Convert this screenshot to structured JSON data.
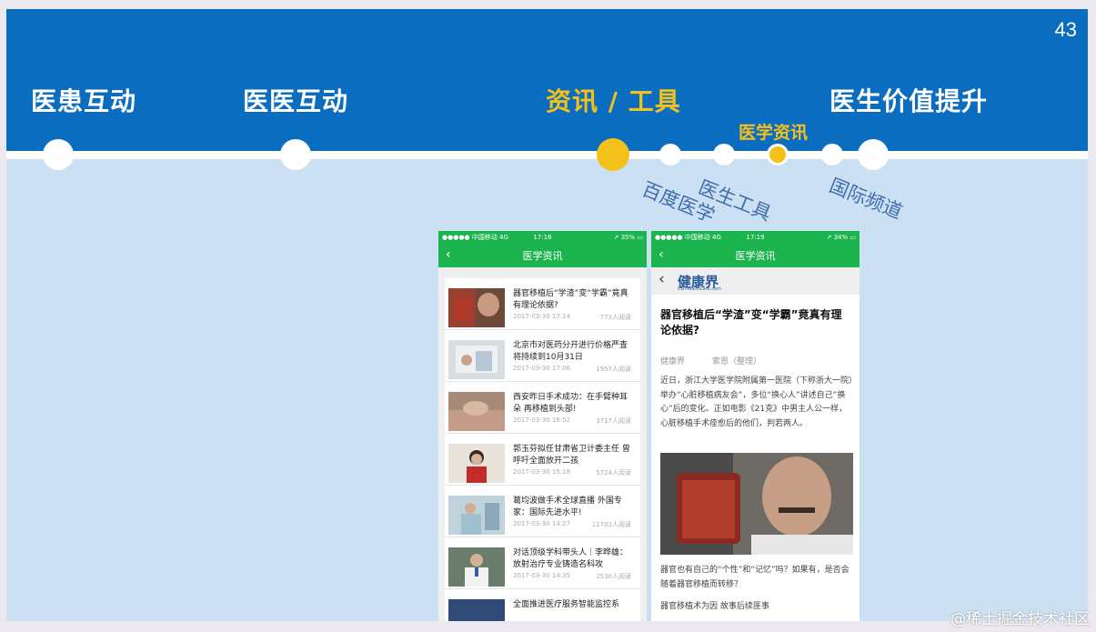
{
  "slide": {
    "number": "43"
  },
  "sections": [
    "医患互动",
    "医医互动",
    "资讯 / 工具",
    "医生价值提升"
  ],
  "active_subsection": "医学资讯",
  "subsections": [
    "百度医学",
    "医生工具",
    "国际频道"
  ],
  "colors": {
    "header_blue": "#0a6dc0",
    "accent_yellow": "#f4c11a",
    "app_green": "#1cb44f",
    "slide_bg": "#cce0f3"
  },
  "phone_left": {
    "status": {
      "left": "●●●●● 中国移动  4G",
      "time": "17:16",
      "right": "↗ 35% ▭"
    },
    "nav_title": "医学资讯",
    "news": [
      {
        "title": "器官移植后“学渣”变“学霸”竟真有理论依据?",
        "date": "2017-03-30 17:14",
        "reads": "773人阅读"
      },
      {
        "title": "北京市对医药分开进行价格严查 将持续到10月31日",
        "date": "2017-03-30 17:06",
        "reads": "1957人阅读"
      },
      {
        "title": "西安昨日手术成功：在手臂种耳朵 再移植到头部!",
        "date": "2017-03-30 16:52",
        "reads": "3717人阅读"
      },
      {
        "title": "郭玉芬拟任甘肃省卫计委主任 曾呼吁全面放开二孩",
        "date": "2017-03-30 15:18",
        "reads": "5724人阅读"
      },
      {
        "title": "葛均波做手术全球直播 外国专家：国际先进水平!",
        "date": "2017-03-30 14:27",
        "reads": "11703人阅读"
      },
      {
        "title": "对话顶级学科带头人｜李晔雄：放射治疗专业铸造名科攻",
        "date": "2017-03-30 14:35",
        "reads": "2530人阅读"
      },
      {
        "title": "全面推进医疗服务智能监控系",
        "date": "",
        "reads": ""
      }
    ]
  },
  "phone_right": {
    "status": {
      "left": "●●●●● 中国移动  4G",
      "time": "17:19",
      "right": "↗ 34% ▭"
    },
    "nav_title": "医学资讯",
    "logo": "健康界",
    "logo_sub": "CN-healthcare.com",
    "article_title": "器官移植后“学渣”变“学霸”竟真有理论依据?",
    "source": "健康界",
    "author": "索恩（整理）",
    "paragraph1": "近日，浙江大学医学院附属第一医院（下称浙大一院）举办“心脏移植病友会”，多位“换心人”讲述自己“换心”后的变化。正如电影《21克》中男主人公一样，心脏移植手术痊愈后的他们，判若两人。",
    "paragraph2": "器官也有自己的“个性”和“记忆”吗？如果有，是否会随着器官移植而转移？",
    "paragraph3": "器官移植术为因 故事后续匪事"
  },
  "watermark": "@稀土掘金技术社区"
}
